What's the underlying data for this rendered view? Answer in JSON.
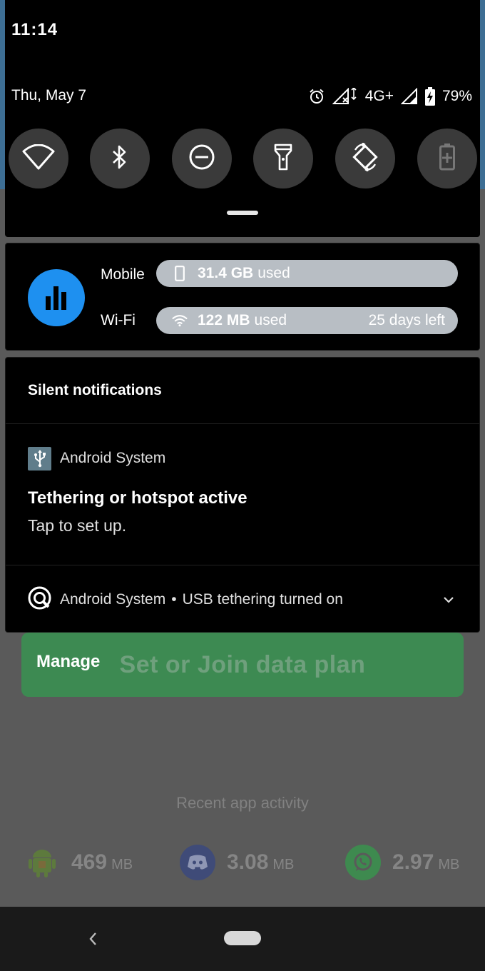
{
  "status_bar": {
    "time": "11:14",
    "date": "Thu, May 7",
    "network": "4G+",
    "battery": "79%"
  },
  "quick_settings": {
    "tiles": [
      {
        "icon": "wifi-icon"
      },
      {
        "icon": "bluetooth-icon"
      },
      {
        "icon": "do-not-disturb-icon"
      },
      {
        "icon": "flashlight-icon"
      },
      {
        "icon": "auto-rotate-icon"
      },
      {
        "icon": "battery-saver-icon"
      }
    ]
  },
  "data_widget": {
    "mobile_label": "Mobile",
    "mobile_amount": "31.4 GB",
    "mobile_suffix": "used",
    "wifi_label": "Wi-Fi",
    "wifi_amount": "122 MB",
    "wifi_suffix": "used",
    "days_left": "25 days left",
    "accent": "#1e90f0"
  },
  "notifications": {
    "section_title": "Silent notifications",
    "items": [
      {
        "app_name": "Android System",
        "title": "Tethering or hotspot active",
        "text": "Tap to set up."
      },
      {
        "app_name": "Android System",
        "separator": "•",
        "summary": "USB tethering turned on"
      }
    ]
  },
  "background_app": {
    "manage_label": "Manage",
    "plan_button": "Set or Join data plan",
    "plan_color": "#3d8a52",
    "recent_title": "Recent app activity",
    "apps": [
      {
        "icon": "android-icon",
        "value": "469",
        "unit": "MB"
      },
      {
        "icon": "discord-icon",
        "value": "3.08",
        "unit": "MB"
      },
      {
        "icon": "whatsapp-icon",
        "value": "2.97",
        "unit": "MB"
      }
    ]
  }
}
